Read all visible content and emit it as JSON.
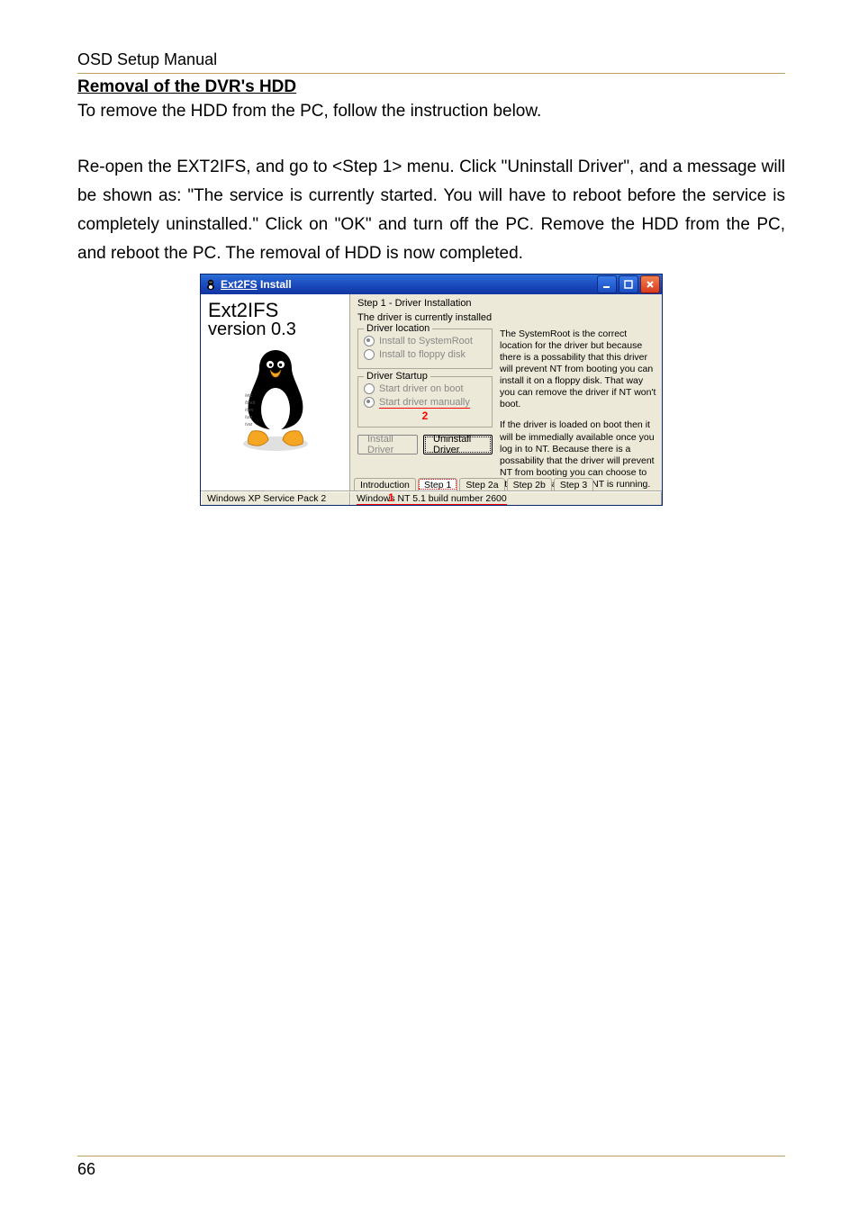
{
  "doc": {
    "header": "OSD Setup Manual",
    "section_title": "Removal of the DVR's HDD",
    "para1": "To remove the HDD from the PC, follow the instruction below.",
    "para2": "Re-open the EXT2IFS, and go to <Step 1> menu. Click \"Uninstall Driver\", and a message will be shown as: \"The service is currently started. You will have to reboot before the service is completely uninstalled.\" Click on \"OK\" and turn off the PC. Remove the HDD from the PC, and reboot the PC. The removal of HDD is now completed.",
    "page_number": "66"
  },
  "win": {
    "title_prefix": "Ext2FS",
    "title_suffix": " Install",
    "app_line1": "Ext2IFS",
    "app_line2": "version 0.3",
    "step_head": "Step 1 - Driver Installation",
    "step_sub": "The driver is currently installed",
    "group_location": {
      "legend": "Driver location",
      "opt1": "Install to SystemRoot",
      "opt2": "Install to floppy disk"
    },
    "group_startup": {
      "legend": "Driver Startup",
      "opt1": "Start driver on boot",
      "opt2": "Start driver manually"
    },
    "desc_location": "The SystemRoot is the correct location for the driver but because there is a possability that this driver will prevent NT from booting you can install it on a floppy disk.  That way you can remove the driver if NT won't boot.",
    "desc_startup": "If the driver is loaded on boot then it will be immedially available once you log in to NT. Because there is a possability that the driver will prevent NT from booting you can choose to start it manually once NT is running.",
    "btn_install": "Install Driver",
    "btn_uninstall": "Uninstall Driver",
    "tabs": [
      "Introduction",
      "Step 1",
      "Step 2a",
      "Step 2b",
      "Step 3"
    ],
    "active_tab_index": 1,
    "annot1": "1",
    "annot2": "2",
    "status_left": "Windows XP Service Pack 2",
    "status_right": "Windows NT 5.1 build number 2600"
  },
  "icons": {
    "penguin": "tux-icon",
    "app": "penguin-app-icon"
  }
}
